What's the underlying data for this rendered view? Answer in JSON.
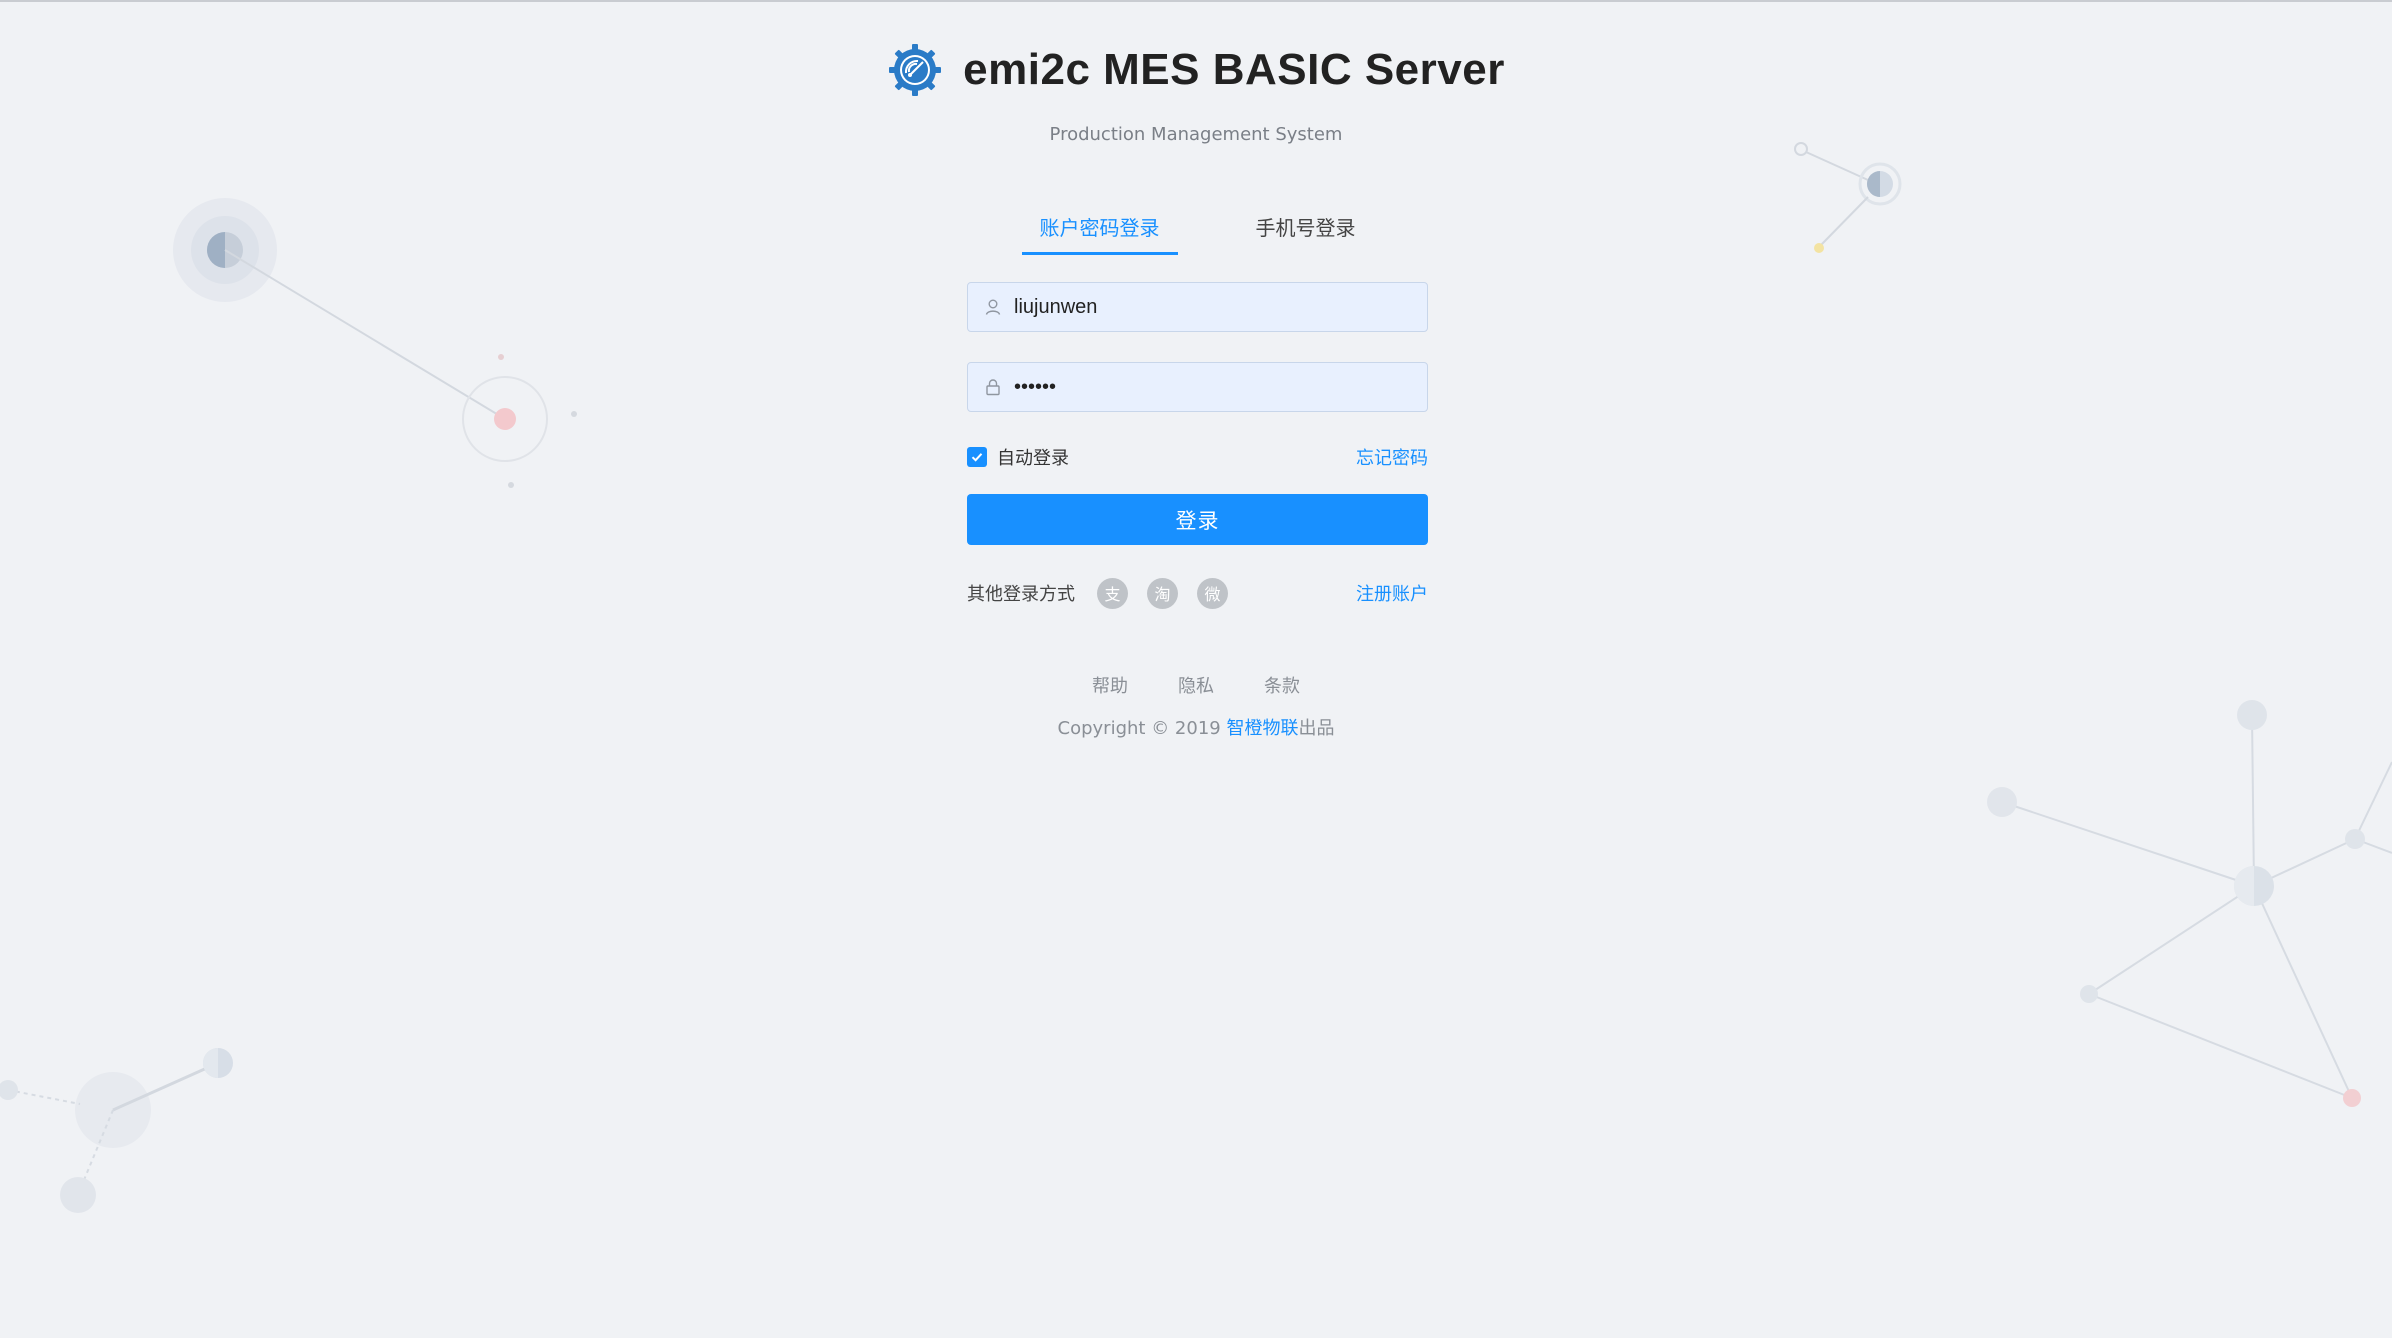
{
  "brand": {
    "title": "emi2c MES BASIC Server",
    "subtitle": "Production Management System",
    "logo_icon": "gear-wifi-logo",
    "accent_color": "#1890ff"
  },
  "tabs": [
    {
      "label": "账户密码登录",
      "active": true
    },
    {
      "label": "手机号登录",
      "active": false
    }
  ],
  "form": {
    "username_value": "liujunwen",
    "password_value": "••••••",
    "remember_label": "自动登录",
    "remember_checked": true,
    "forgot_label": "忘记密码",
    "submit_label": "登录",
    "other_label": "其他登录方式",
    "social_icons": [
      "alipay-icon",
      "taobao-icon",
      "weibo-icon"
    ],
    "social_glyphs": [
      "支",
      "淘",
      "微"
    ],
    "register_label": "注册账户"
  },
  "footer": {
    "links": [
      "帮助",
      "隐私",
      "条款"
    ],
    "copyright_prefix": "Copyright ",
    "copyright_symbol": "©",
    "copyright_year": " 2019 ",
    "company": "智橙物联",
    "copyright_suffix": "出品"
  }
}
